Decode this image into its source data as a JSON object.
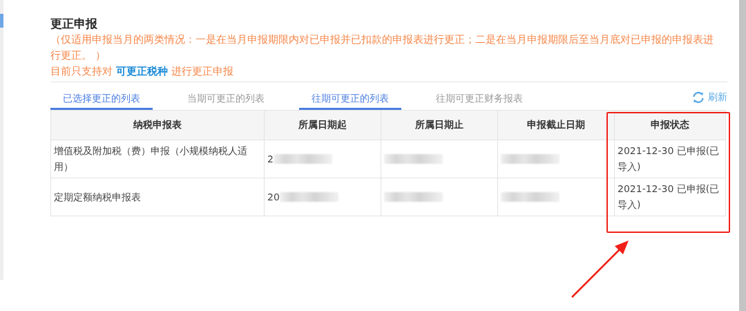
{
  "title": "更正申报",
  "notice": [
    "（仅适用申报当月的两类情况：一是在当月申报期限内对已申报并已扣款的申报表进行更正；二是在当月申报期限后至当月底对已申报的申报表进行更正。 ）"
  ],
  "support": {
    "before": "目前只支持对",
    "link": "可更正税种",
    "after": "进行更正申报"
  },
  "tabs": [
    {
      "label": "已选择更正的列表",
      "selected": true
    },
    {
      "label": "当期可更正的列表",
      "selected": false
    },
    {
      "label": "往期可更正的列表",
      "selected": true
    },
    {
      "label": "往期可更正财务报表",
      "selected": false
    }
  ],
  "refresh": "刷新",
  "table": {
    "columns": [
      "纳税申报表",
      "所属日期起",
      "所属日期止",
      "申报截止日期",
      "申报状态"
    ],
    "rows": [
      {
        "cells": [
          {
            "text": "增值税及附加税（费）申报（小规模纳税人适用）",
            "redacted": false
          },
          {
            "text": "2",
            "redacted": true
          },
          {
            "redacted": true
          },
          {
            "redacted": true
          },
          {
            "text": "2021-12-30 已申报(已导入)",
            "redacted": false
          }
        ]
      },
      {
        "cells": [
          {
            "text": "定期定额纳税申报表",
            "redacted": false
          },
          {
            "text": "20",
            "redacted": true
          },
          {
            "redacted": true
          },
          {
            "redacted": true
          },
          {
            "text": "2021-12-30 已申报(已导入)",
            "redacted": false
          }
        ]
      }
    ]
  },
  "annotations": {
    "highlight_box": true,
    "arrow": true
  }
}
